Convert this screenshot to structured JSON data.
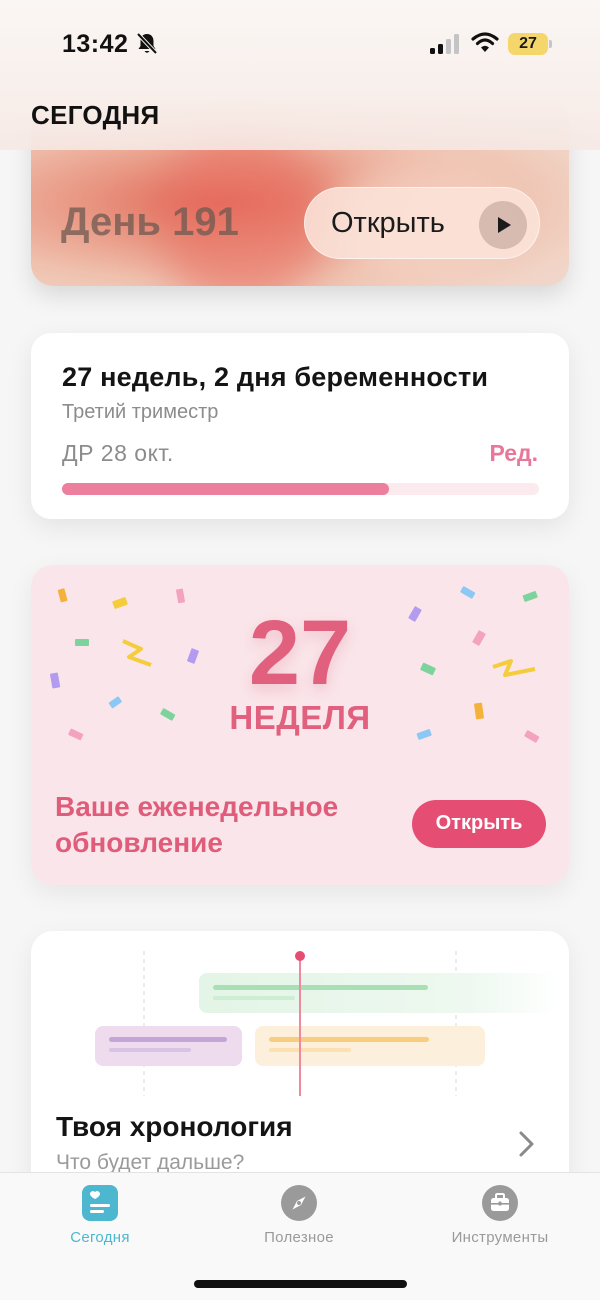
{
  "status_bar": {
    "time": "13:42",
    "battery_level": "27",
    "icons": [
      "bell-slash-icon",
      "signal-icon",
      "wifi-icon",
      "battery-icon"
    ]
  },
  "header": {
    "title": "СЕГОДНЯ"
  },
  "day_card": {
    "label": "День 191",
    "open_label": "Открыть",
    "icon": "play-icon"
  },
  "pregnancy_card": {
    "title": "27 недель, 2 дня беременности",
    "trimester": "Третий триместр",
    "due_date": "ДР 28 окт.",
    "edit_label": "Ред.",
    "progress_fraction": 0.685,
    "colors": {
      "progress": "#ec7f9e",
      "track": "#fbeaee",
      "edit": "#e8779b"
    }
  },
  "week_card": {
    "number": "27",
    "label": "НЕДЕЛЯ",
    "update_text": "Ваше еженедельное обновление",
    "open_label": "Открыть",
    "colors": {
      "background": "#fae6ea",
      "accent": "#e0607e",
      "button": "#e64d73"
    }
  },
  "timeline_card": {
    "title": "Твоя хронология",
    "subtitle": "Что будет дальше?",
    "icon": "chevron-right-icon"
  },
  "tab_bar": {
    "tabs": [
      {
        "label": "Сегодня",
        "icon": "today-icon",
        "active": true,
        "color": "#4db7cf"
      },
      {
        "label": "Полезное",
        "icon": "compass-icon",
        "active": false,
        "color": "#9a9a9a"
      },
      {
        "label": "Инструменты",
        "icon": "toolbox-icon",
        "active": false,
        "color": "#9a9a9a"
      }
    ]
  }
}
